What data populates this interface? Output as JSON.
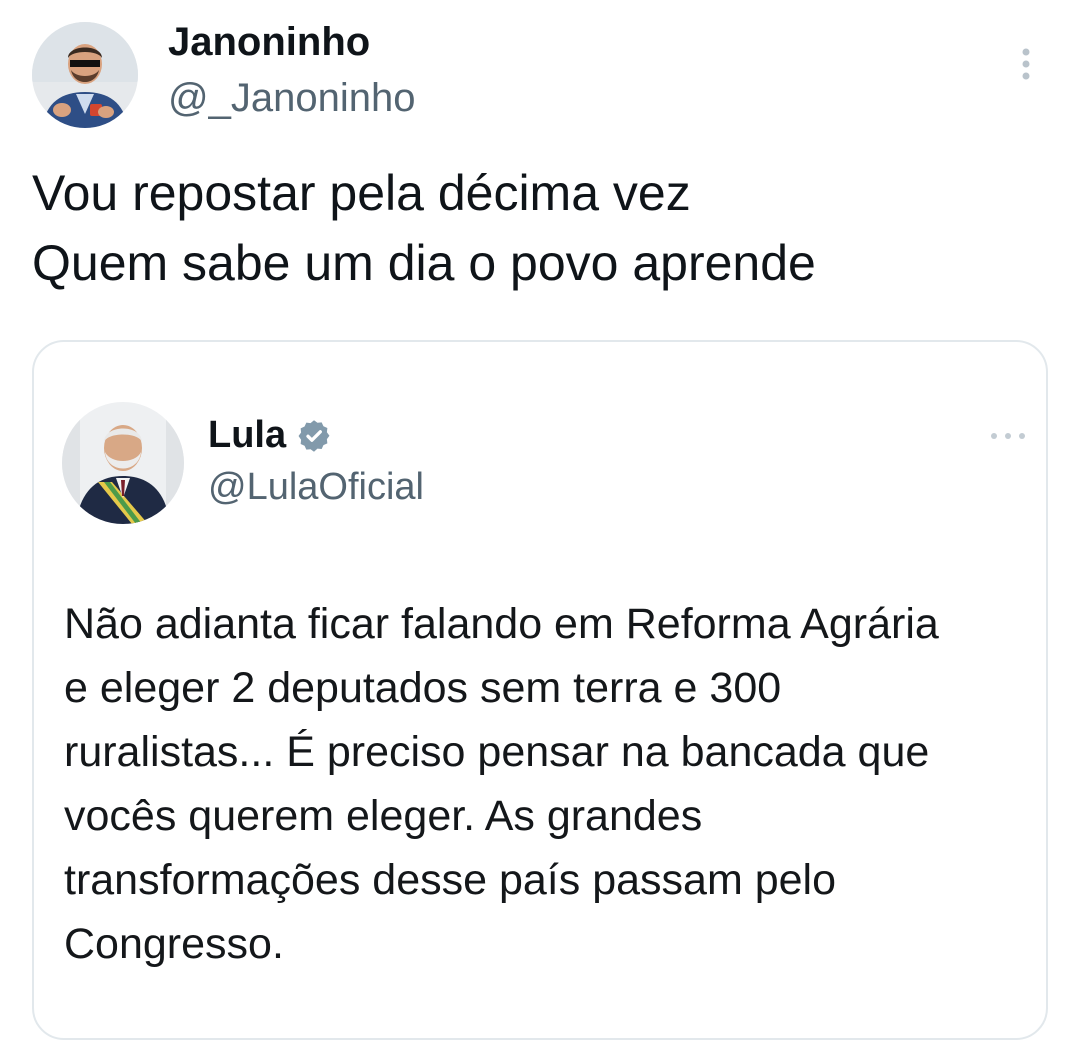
{
  "tweet": {
    "author": {
      "display_name": "Janoninho",
      "handle": "@_Janoninho"
    },
    "text_lines": [
      "Vou repostar pela décima vez",
      "Quem sabe um dia o povo aprende"
    ],
    "more_icon": "more-vertical-icon"
  },
  "quoted_tweet": {
    "author": {
      "display_name": "Lula",
      "handle": "@LulaOficial",
      "verified_icon": "verified-badge-icon",
      "verified_color": "#829aab"
    },
    "more_icon": "more-horizontal-icon",
    "text_lines": [
      "Não adianta ficar falando em Reforma Agrária",
      "e eleger 2 deputados sem terra e 300",
      "ruralistas... É preciso pensar na bancada que",
      "vocês querem eleger. As grandes",
      "transformações desse país passam pelo",
      "Congresso."
    ]
  },
  "colors": {
    "text_primary": "#0f1419",
    "text_secondary": "#536471",
    "border": "#e2e8ec"
  }
}
